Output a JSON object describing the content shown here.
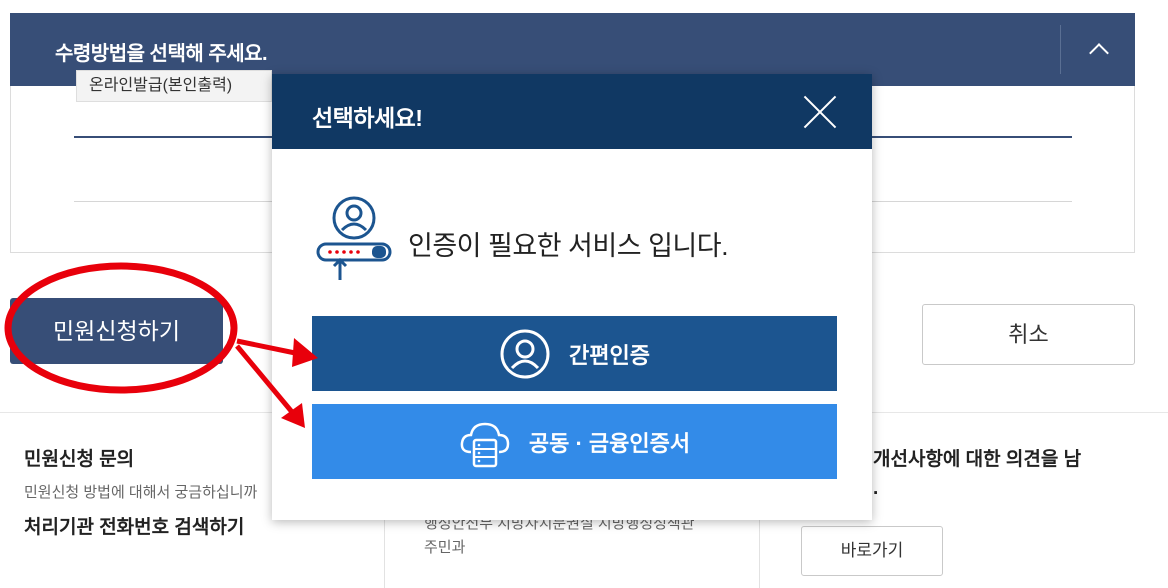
{
  "section": {
    "title": "수령방법을 선택해 주세요.",
    "method_option": "온라인발급(본인출력)"
  },
  "actions": {
    "apply_label": "민원신청하기",
    "cancel_label": "취소"
  },
  "info": {
    "col1_title": "민원신청 문의",
    "col1_desc": "민원신청 방법에 대해서 궁금하십니까",
    "col1_link": "처리기관 전화번호 검색하기",
    "col2_line1": "행정안전부 지방자치분권실 지방행정정책관",
    "col2_line2": "주민과",
    "col3_title": "개선사항에 대한 의견을 남",
    "col3_title2": ".",
    "goto_label": "바로가기"
  },
  "modal": {
    "title": "선택하세요!",
    "message": "인증이 필요한 서비스 입니다.",
    "simple_auth_label": "간편인증",
    "cert_auth_label": "공동 · 금융인증서"
  },
  "colors": {
    "header_bar": "#374e77",
    "modal_header": "#103863",
    "simple_btn": "#1c5590",
    "cert_btn": "#338be8",
    "annotation": "#e8000b"
  }
}
